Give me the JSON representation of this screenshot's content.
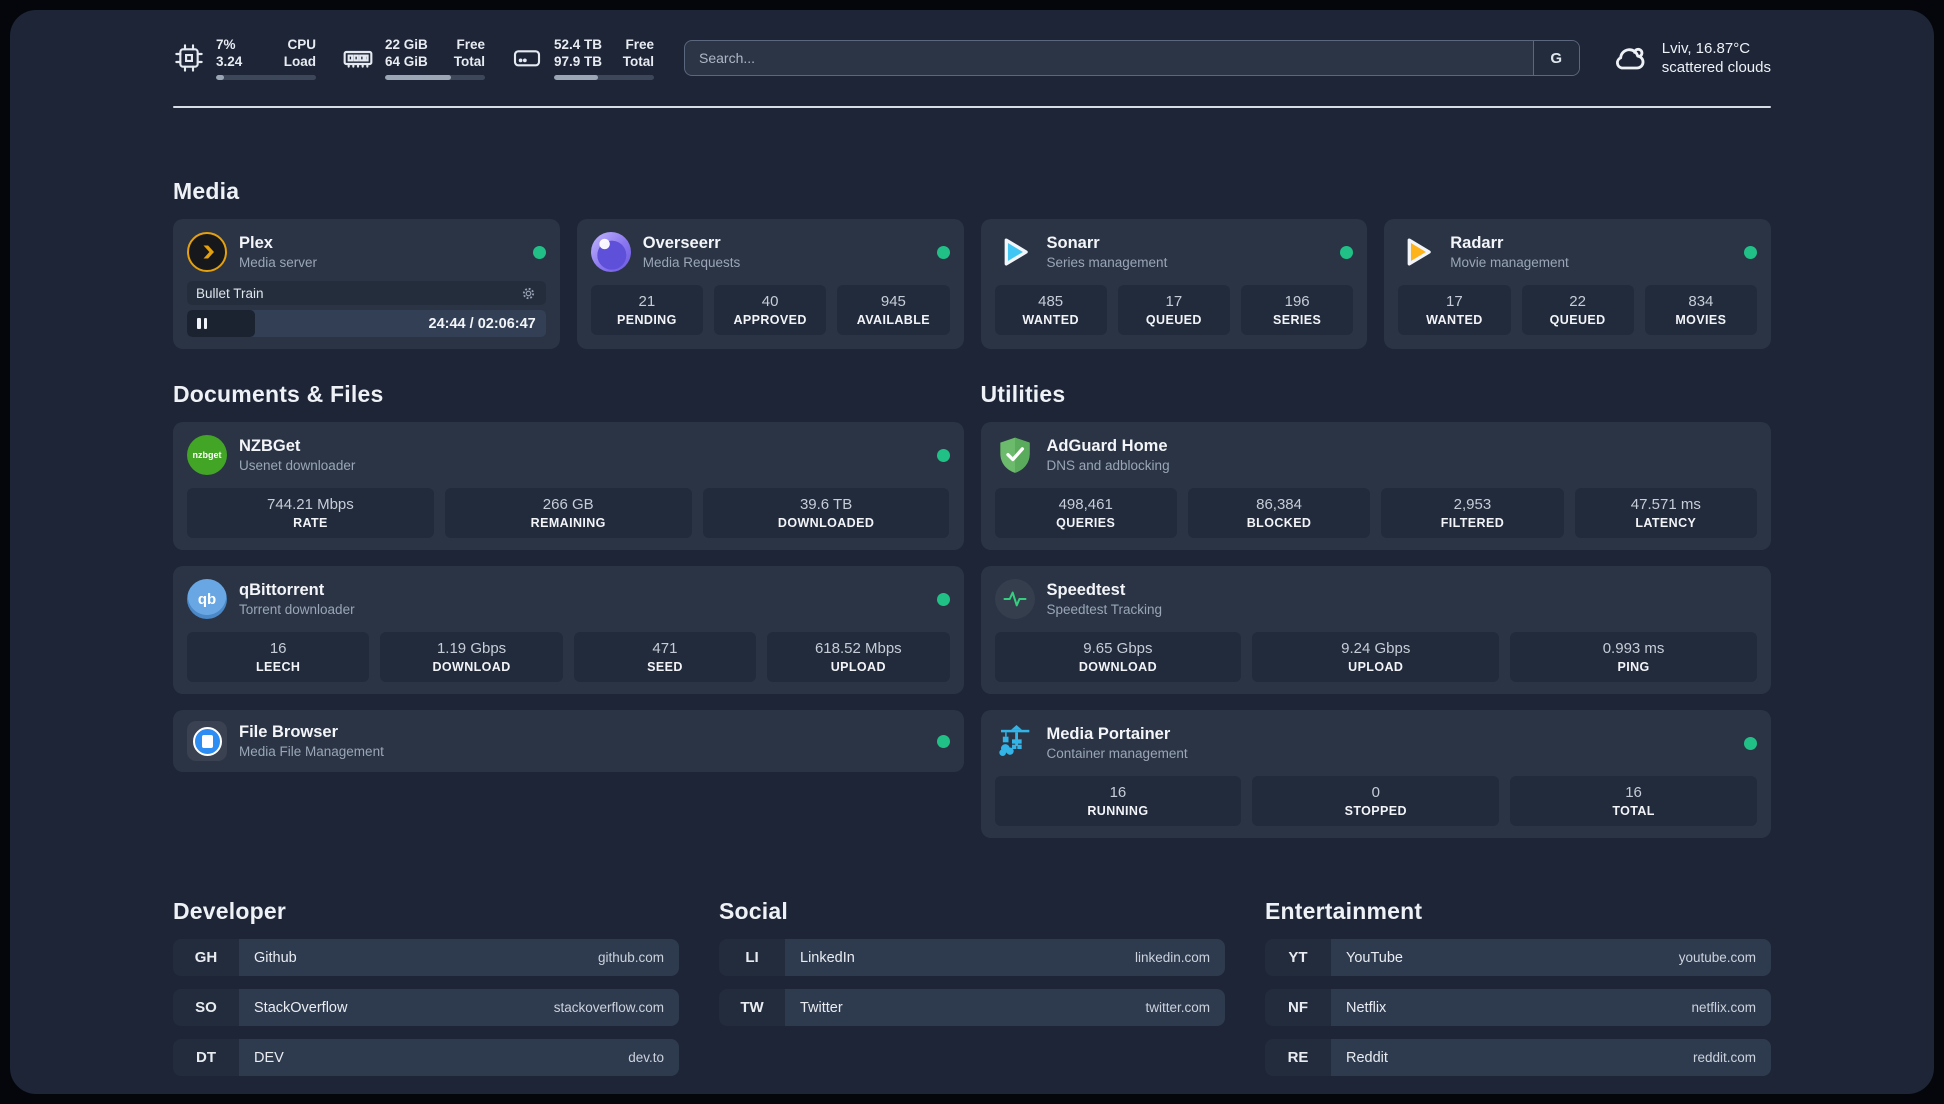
{
  "header": {
    "cpu": {
      "values": [
        "7%",
        "3.24"
      ],
      "labels": [
        "CPU",
        "Load"
      ],
      "progress_pct": 8
    },
    "memory": {
      "values": [
        "22 GiB",
        "64 GiB"
      ],
      "labels": [
        "Free",
        "Total"
      ],
      "progress_pct": 66
    },
    "storage": {
      "values": [
        "52.4 TB",
        "97.9 TB"
      ],
      "labels": [
        "Free",
        "Total"
      ],
      "progress_pct": 44
    },
    "search": {
      "placeholder": "Search...",
      "engine_button": "G"
    },
    "weather": {
      "location_temp": "Lviv, 16.87°C",
      "condition": "scattered clouds"
    }
  },
  "sections": {
    "media": {
      "title": "Media",
      "plex": {
        "name": "Plex",
        "description": "Media server",
        "status": "online",
        "player": {
          "title": "Bullet Train",
          "time": "24:44 / 02:06:47",
          "progress_pct": 19
        }
      },
      "overseerr": {
        "name": "Overseerr",
        "description": "Media Requests",
        "status": "online",
        "stats": [
          {
            "value": "21",
            "label": "PENDING"
          },
          {
            "value": "40",
            "label": "APPROVED"
          },
          {
            "value": "945",
            "label": "AVAILABLE"
          }
        ]
      },
      "sonarr": {
        "name": "Sonarr",
        "description": "Series management",
        "status": "online",
        "stats": [
          {
            "value": "485",
            "label": "WANTED"
          },
          {
            "value": "17",
            "label": "QUEUED"
          },
          {
            "value": "196",
            "label": "SERIES"
          }
        ]
      },
      "radarr": {
        "name": "Radarr",
        "description": "Movie management",
        "status": "online",
        "stats": [
          {
            "value": "17",
            "label": "WANTED"
          },
          {
            "value": "22",
            "label": "QUEUED"
          },
          {
            "value": "834",
            "label": "MOVIES"
          }
        ]
      }
    },
    "documents": {
      "title": "Documents & Files",
      "nzbget": {
        "name": "NZBGet",
        "description": "Usenet downloader",
        "status": "online",
        "icon_text": "nzbget",
        "stats": [
          {
            "value": "744.21 Mbps",
            "label": "RATE"
          },
          {
            "value": "266 GB",
            "label": "REMAINING"
          },
          {
            "value": "39.6 TB",
            "label": "DOWNLOADED"
          }
        ]
      },
      "qbittorrent": {
        "name": "qBittorrent",
        "description": "Torrent downloader",
        "status": "online",
        "icon_text": "qb",
        "stats": [
          {
            "value": "16",
            "label": "LEECH"
          },
          {
            "value": "1.19 Gbps",
            "label": "DOWNLOAD"
          },
          {
            "value": "471",
            "label": "SEED"
          },
          {
            "value": "618.52 Mbps",
            "label": "UPLOAD"
          }
        ]
      },
      "filebrowser": {
        "name": "File Browser",
        "description": "Media File Management",
        "status": "online"
      }
    },
    "utilities": {
      "title": "Utilities",
      "adguard": {
        "name": "AdGuard Home",
        "description": "DNS and adblocking",
        "stats": [
          {
            "value": "498,461",
            "label": "QUERIES"
          },
          {
            "value": "86,384",
            "label": "BLOCKED"
          },
          {
            "value": "2,953",
            "label": "FILTERED"
          },
          {
            "value": "47.571 ms",
            "label": "LATENCY"
          }
        ]
      },
      "speedtest": {
        "name": "Speedtest",
        "description": "Speedtest Tracking",
        "stats": [
          {
            "value": "9.65 Gbps",
            "label": "DOWNLOAD"
          },
          {
            "value": "9.24 Gbps",
            "label": "UPLOAD"
          },
          {
            "value": "0.993 ms",
            "label": "PING"
          }
        ]
      },
      "portainer": {
        "name": "Media Portainer",
        "description": "Container management",
        "status": "online",
        "stats": [
          {
            "value": "16",
            "label": "RUNNING"
          },
          {
            "value": "0",
            "label": "STOPPED"
          },
          {
            "value": "16",
            "label": "TOTAL"
          }
        ]
      }
    },
    "developer": {
      "title": "Developer",
      "items": [
        {
          "abbr": "GH",
          "name": "Github",
          "url": "github.com"
        },
        {
          "abbr": "SO",
          "name": "StackOverflow",
          "url": "stackoverflow.com"
        },
        {
          "abbr": "DT",
          "name": "DEV",
          "url": "dev.to"
        }
      ]
    },
    "social": {
      "title": "Social",
      "items": [
        {
          "abbr": "LI",
          "name": "LinkedIn",
          "url": "linkedin.com"
        },
        {
          "abbr": "TW",
          "name": "Twitter",
          "url": "twitter.com"
        }
      ]
    },
    "entertainment": {
      "title": "Entertainment",
      "items": [
        {
          "abbr": "YT",
          "name": "YouTube",
          "url": "youtube.com"
        },
        {
          "abbr": "NF",
          "name": "Netflix",
          "url": "netflix.com"
        },
        {
          "abbr": "RE",
          "name": "Reddit",
          "url": "reddit.com"
        }
      ]
    }
  },
  "colors": {
    "page_bg": "#1d2536",
    "card_bg": "#2a3445",
    "stat_box_bg": "#222b3b",
    "status_green": "#20c087",
    "plex_orange": "#e5a00d",
    "sonarr_blue": "#3fc6f3",
    "radarr_yellow": "#ffb31a",
    "nzbget_green": "#43a526",
    "qbittorrent_blue": "#4a88c8",
    "adguard_green": "#63b663",
    "speedtest_green": "#35d07f",
    "portainer_blue": "#33b3e6",
    "divider": "#d7dde5"
  }
}
